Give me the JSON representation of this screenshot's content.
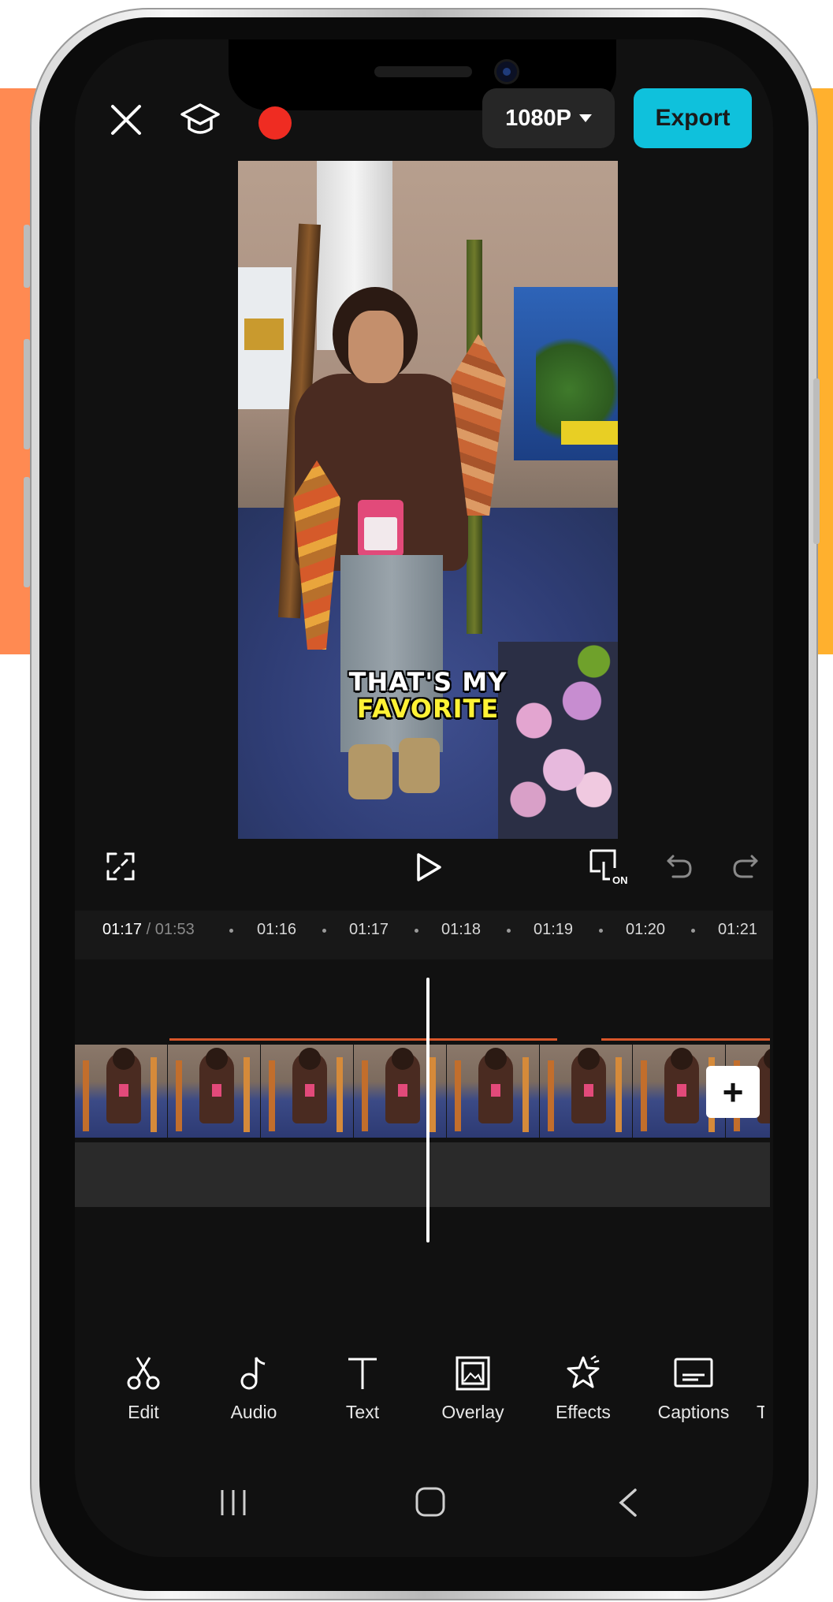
{
  "top_bar": {
    "resolution": "1080P"
  },
  "export_button": "Export",
  "preview": {
    "caption_line1": "THAT'S MY",
    "caption_line2": "FAVORITE"
  },
  "timeline": {
    "current_time": "01:17",
    "total_time": "/ 01:53",
    "ticks": [
      "01:16",
      "01:17",
      "01:18",
      "01:19",
      "01:20",
      "01:21"
    ]
  },
  "playback_controls": {
    "captions_toggle_state": "ON"
  },
  "tools": [
    {
      "label": "Edit",
      "icon": "scissors-icon"
    },
    {
      "label": "Audio",
      "icon": "music-note-icon"
    },
    {
      "label": "Text",
      "icon": "text-icon"
    },
    {
      "label": "Overlay",
      "icon": "overlay-icon"
    },
    {
      "label": "Effects",
      "icon": "effects-star-icon"
    },
    {
      "label": "Captions",
      "icon": "captions-icon"
    },
    {
      "label": "T",
      "icon": "truncated-tool"
    }
  ],
  "colors": {
    "accent": "#0fc1dc",
    "record": "#ef2c22",
    "left_bg": "#ff8a52",
    "right_bg": "#ffb02e"
  }
}
